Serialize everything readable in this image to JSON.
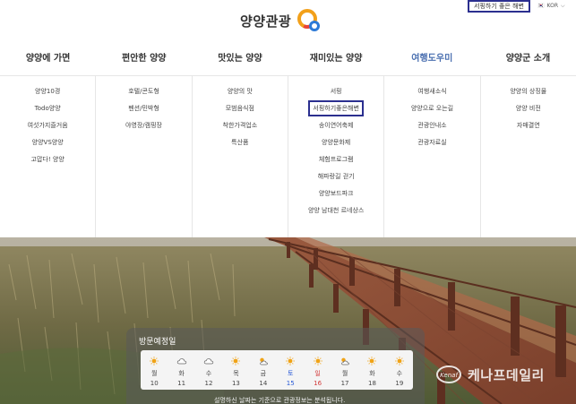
{
  "header": {
    "logo_text": "양양관광",
    "surf_link": "서핑하기 좋은 해변",
    "lang": {
      "flag": "🇰🇷",
      "code": "KOR"
    }
  },
  "nav": [
    {
      "label": "양양에 가면",
      "active": false
    },
    {
      "label": "편안한 양양",
      "active": false
    },
    {
      "label": "맛있는 양양",
      "active": false
    },
    {
      "label": "재미있는 양양",
      "active": false
    },
    {
      "label": "여행도우미",
      "active": true
    },
    {
      "label": "양양군 소개",
      "active": false
    }
  ],
  "menu": [
    [
      "양양10경",
      "Todo양양",
      "여섯가지즐거움",
      "양양VS양양",
      "고맙다! 양양"
    ],
    [
      "호텔/콘도형",
      "펜션/민박형",
      "야영장/캠핑장"
    ],
    [
      "양양의 맛",
      "모범음식점",
      "착한가격업소",
      "특산품"
    ],
    [
      "서핑",
      "서핑하기좋은해변",
      "송이연어축제",
      "양양문화제",
      "체험프로그램",
      "해파랑길 걷기",
      "양양보드파크",
      "양양 남대천 르네상스"
    ],
    [
      "여행새소식",
      "양양으로 오는길",
      "관광안내소",
      "관광자료실"
    ],
    [
      "양양의 상징물",
      "양양 비전",
      "자매결연"
    ]
  ],
  "weather": {
    "title": "방문예정일",
    "days": [
      {
        "name": "월",
        "date": "10",
        "icon": "sunny-icon",
        "type": "weekday"
      },
      {
        "name": "화",
        "date": "11",
        "icon": "cloudy-icon",
        "type": "weekday"
      },
      {
        "name": "수",
        "date": "12",
        "icon": "cloudy-icon",
        "type": "weekday"
      },
      {
        "name": "목",
        "date": "13",
        "icon": "sunny-icon",
        "type": "weekday"
      },
      {
        "name": "금",
        "date": "14",
        "icon": "partly-cloudy-icon",
        "type": "weekday"
      },
      {
        "name": "토",
        "date": "15",
        "icon": "sunny-icon",
        "type": "sat"
      },
      {
        "name": "일",
        "date": "16",
        "icon": "sunny-icon",
        "type": "sun"
      },
      {
        "name": "월",
        "date": "17",
        "icon": "partly-cloudy-icon",
        "type": "weekday"
      },
      {
        "name": "화",
        "date": "18",
        "icon": "sunny-icon",
        "type": "weekday"
      },
      {
        "name": "수",
        "date": "19",
        "icon": "sunny-icon",
        "type": "weekday"
      }
    ],
    "note": "설명하신 날짜는 기준으로 관광정보는 분석됩니다."
  },
  "watermark": {
    "text": "케나프데일리",
    "mark_text": "Kenaf"
  },
  "colors": {
    "accent": "#2b2f8f",
    "nav_active": "#4a6fb0",
    "saturday": "#2a5bd7",
    "sunday": "#d23a3a"
  }
}
